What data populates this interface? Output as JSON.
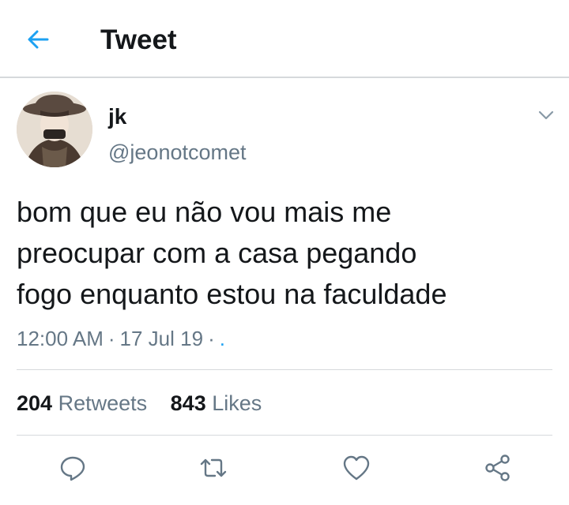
{
  "header": {
    "title": "Tweet",
    "back_icon": "arrow-left-icon",
    "accent_color": "#1da1f2"
  },
  "tweet": {
    "author": {
      "display_name": "jk",
      "handle": "@jeonotcomet"
    },
    "text_lines": [
      "bom que eu não vou mais me",
      "preocupar com a casa pegando",
      "fogo enquanto estou na faculdade"
    ],
    "time": "12:00 AM",
    "date": "17 Jul 19",
    "source": ".",
    "separator": "·"
  },
  "stats": {
    "retweets_count": "204",
    "retweets_label": "Retweets",
    "likes_count": "843",
    "likes_label": "Likes"
  },
  "actions": [
    {
      "name": "reply",
      "icon": "speech-bubble-icon"
    },
    {
      "name": "retweet",
      "icon": "retweet-arrows-icon"
    },
    {
      "name": "like",
      "icon": "heart-icon"
    },
    {
      "name": "share",
      "icon": "share-nodes-icon"
    }
  ],
  "colors": {
    "text": "#14171a",
    "secondary": "#657786",
    "divider": "#d6d9dc",
    "accent": "#1da1f2"
  }
}
